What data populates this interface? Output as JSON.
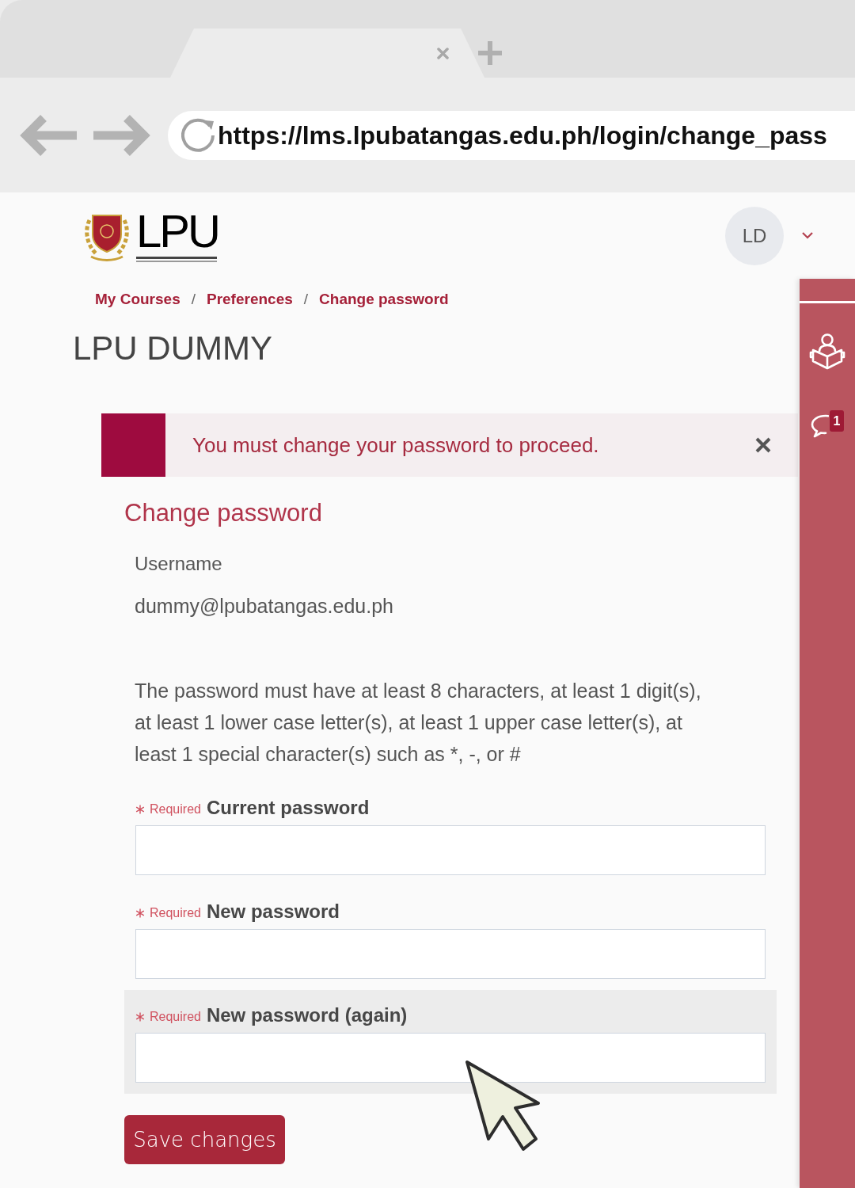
{
  "browser": {
    "url": "https://lms.lpubatangas.edu.ph/login/change_pass"
  },
  "header": {
    "logo_text": "LPU",
    "user_initials": "LD"
  },
  "breadcrumb": [
    {
      "label": "My Courses",
      "separator": "/"
    },
    {
      "label": "Preferences",
      "separator": "/"
    },
    {
      "label": "Change password"
    }
  ],
  "page_title": "LPU DUMMY",
  "alert": {
    "message": "You must change your password to proceed."
  },
  "form": {
    "title": "Change password",
    "username_label": "Username",
    "username_value": "dummy@lpubatangas.edu.ph",
    "password_rules": "The password must have at least 8 characters, at least 1 digit(s), at least 1 lower case letter(s), at least 1 upper case letter(s), at least 1 special character(s) such as *, -, or #",
    "fields": [
      {
        "label": "Current password",
        "required": true,
        "required_text": "Required",
        "highlighted": false
      },
      {
        "label": "New password",
        "required": true,
        "required_text": "Required",
        "highlighted": false
      },
      {
        "label": "New password (again)",
        "required": true,
        "required_text": "Required",
        "highlighted": true
      }
    ],
    "submit": "Save changes"
  },
  "drawer": {
    "items": [
      {
        "kind": "courses"
      },
      {
        "kind": "messages",
        "badge": "1"
      }
    ]
  }
}
